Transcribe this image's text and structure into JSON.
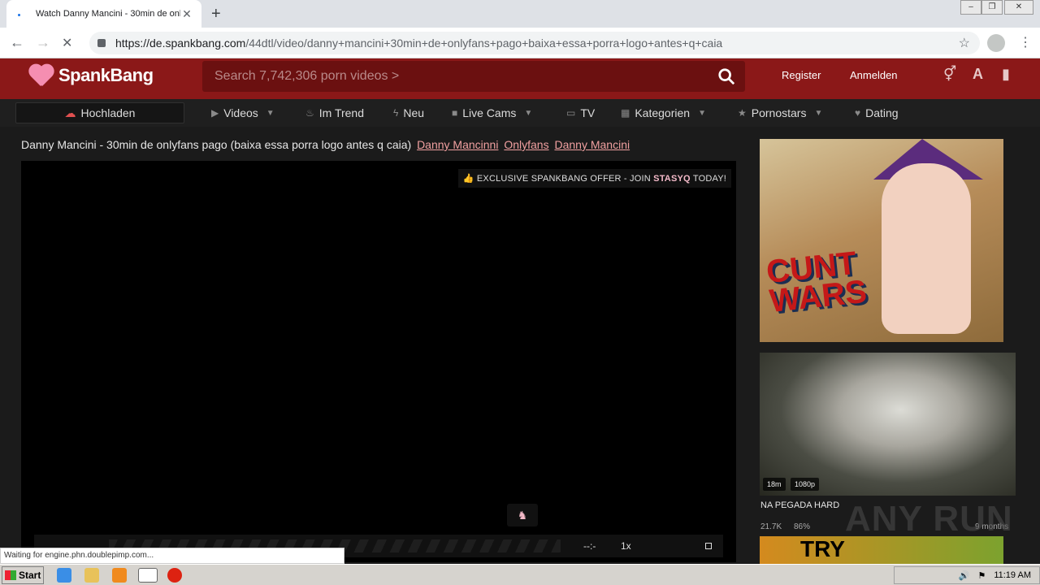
{
  "browser": {
    "tab_title": "Watch Danny Mancini - 30min de onl",
    "tab_close": "✕",
    "new_tab": "+",
    "url_host": "https://de.spankbang.com",
    "url_path": "/44dtl/video/danny+mancini+30min+de+onlyfans+pago+baixa+essa+porra+logo+antes+q+caia",
    "status": "Waiting for engine.phn.doublepimp.com..."
  },
  "header": {
    "logo_text": "SpankBang",
    "search_placeholder": "Search 7,742,306 porn videos >",
    "register": "Register",
    "login": "Anmelden"
  },
  "nav": {
    "upload": "Hochladen",
    "items": [
      {
        "label": "Videos",
        "icon": "play-icon",
        "caret": true
      },
      {
        "label": "Im Trend",
        "icon": "flame-icon",
        "caret": false
      },
      {
        "label": "Neu",
        "icon": "bolt-icon",
        "caret": false
      },
      {
        "label": "Live Cams",
        "icon": "camera-icon",
        "caret": true
      },
      {
        "label": "TV",
        "icon": "tv-icon",
        "caret": false
      },
      {
        "label": "Kategorien",
        "icon": "grid-icon",
        "caret": true
      },
      {
        "label": "Pornostars",
        "icon": "star-icon",
        "caret": true
      },
      {
        "label": "Dating",
        "icon": "heart-icon",
        "caret": false
      }
    ]
  },
  "video": {
    "title": "Danny Mancini - 30min de onlyfans pago (baixa essa porra logo antes q caia)",
    "tags": [
      "Danny Mancinni",
      "Onlyfans",
      "Danny Mancini"
    ],
    "offer_prefix": "EXCLUSIVE SPANKBANG OFFER - JOIN",
    "offer_brand": "STASYQ",
    "offer_suffix": "TODAY!",
    "time": "--:-",
    "speed": "1x"
  },
  "sidebar": {
    "ad_text_line1": "CUNT",
    "ad_text_line2": "WARS",
    "thumb_duration": "18m",
    "thumb_quality": "1080p",
    "thumb_title": "NA PEGADA HARD",
    "thumb_views": "21.7K",
    "thumb_rating": "86%",
    "thumb_age": "9 months",
    "next_ad_text": "TRY"
  },
  "watermark": "ANY RUN",
  "taskbar": {
    "start": "Start",
    "time": "11:19 AM"
  },
  "colors": {
    "header_bg": "#8b1818",
    "accent_pink": "#f0a0a0",
    "nav_bg": "#1f1f1f"
  }
}
